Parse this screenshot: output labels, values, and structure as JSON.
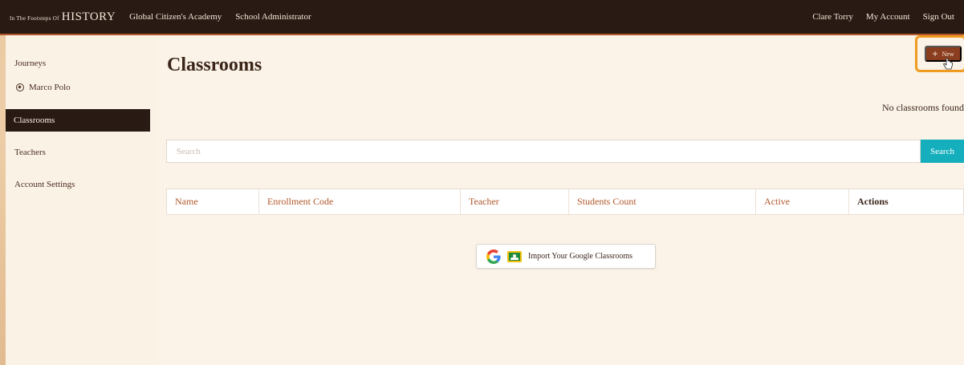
{
  "topbar": {
    "brand_small": "In The Footsteps Of",
    "brand_big": "HISTORY",
    "school": "Global Citizen's Academy",
    "role": "School Administrator",
    "user": "Clare Torry",
    "my_account": "My Account",
    "sign_out": "Sign Out"
  },
  "sidebar": {
    "journeys": "Journeys",
    "journey_item": "Marco Polo",
    "classrooms": "Classrooms",
    "teachers": "Teachers",
    "account_settings": "Account Settings"
  },
  "main": {
    "title": "Classrooms",
    "new_button": "New",
    "empty_message": "No classrooms found",
    "search_placeholder": "Search",
    "search_button": "Search",
    "columns": [
      "Name",
      "Enrollment Code",
      "Teacher",
      "Students Count",
      "Active",
      "Actions"
    ],
    "import_button": "Import Your Google Classrooms"
  },
  "colors": {
    "topbar_bg": "#2a1a14",
    "accent_brown": "#8a3e1f",
    "search_teal": "#14aebc",
    "highlight_orange": "#f09b1f"
  }
}
